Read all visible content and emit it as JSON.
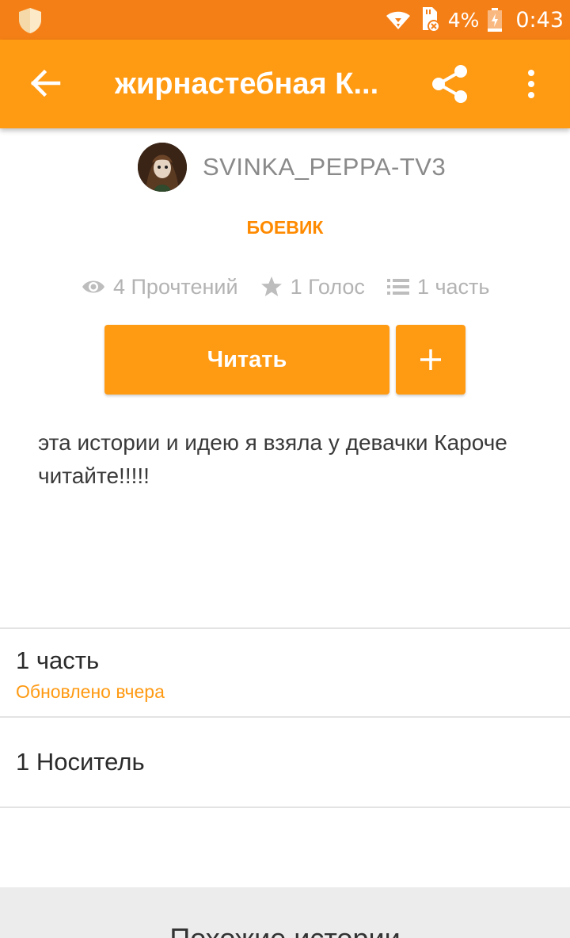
{
  "status_bar": {
    "battery_percent": "4%",
    "time": "0:43"
  },
  "app_bar": {
    "title": "жирнастебная К..."
  },
  "story": {
    "author": "SVINKA_PEPPA-TV3",
    "genre": "БОЕВИК",
    "stats": {
      "reads": "4 Прочтений",
      "votes": "1 Голос",
      "parts": "1 часть"
    },
    "read_button": "Читать",
    "add_button": "+",
    "description": "эта истории и идею я взяла у девачки Кароче читайте!!!!!"
  },
  "parts_section": {
    "label": "1 часть",
    "updated": "Обновлено вчера"
  },
  "media_section": {
    "label": "1 Носитель"
  },
  "similar_section": {
    "heading": "Похожие истории"
  },
  "colors": {
    "accent": "#FF9A13",
    "status_bar": "#F57F17",
    "genre": "#FF8A00"
  },
  "icons": [
    "shield-icon",
    "wifi-icon",
    "sd-card-icon",
    "battery-icon",
    "back-arrow-icon",
    "share-icon",
    "more-vert-icon",
    "eye-icon",
    "star-icon",
    "list-icon",
    "plus-icon"
  ]
}
